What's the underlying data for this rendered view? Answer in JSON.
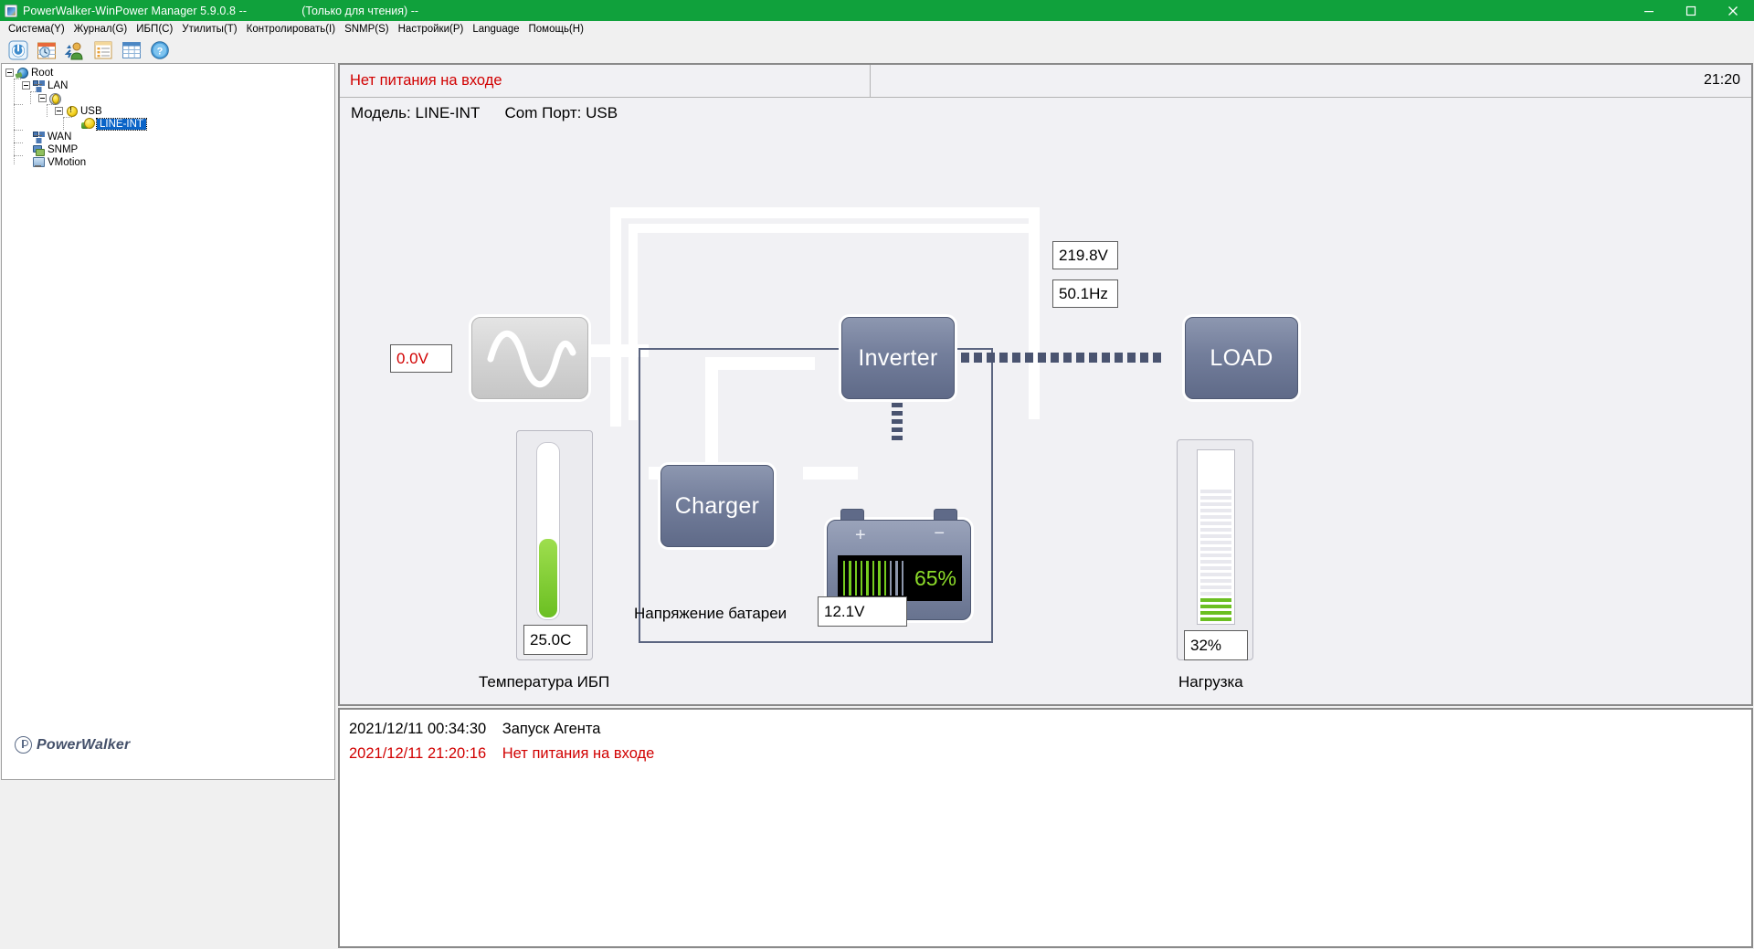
{
  "window": {
    "title": "PowerWalker-WinPower Manager 5.9.0.8 --",
    "readonly": "(Только для чтения) --",
    "app_icon": "java-coffee-icon",
    "minimize": "minimize-icon",
    "maximize": "maximize-icon",
    "close": "close-icon"
  },
  "menubar": {
    "items": [
      {
        "label": "Система(Y)"
      },
      {
        "label": "Журнал(G)"
      },
      {
        "label": "ИБП(C)"
      },
      {
        "label": "Утилиты(T)"
      },
      {
        "label": "Контролировать(I)"
      },
      {
        "label": "SNMP(S)"
      },
      {
        "label": "Настройки(P)"
      },
      {
        "label": "Language"
      },
      {
        "label": "Помощь(H)"
      }
    ]
  },
  "toolbar": {
    "buttons": [
      {
        "name": "power-button-icon"
      },
      {
        "name": "schedule-calendar-icon"
      },
      {
        "name": "user-shutdown-icon"
      },
      {
        "name": "event-log-icon"
      },
      {
        "name": "data-table-icon"
      },
      {
        "name": "help-question-icon"
      }
    ]
  },
  "tree": {
    "nodes": [
      {
        "label": "Root",
        "icon": "globe-icon",
        "selected": false
      },
      {
        "label": "LAN",
        "icon": "lan-icon",
        "selected": false
      },
      {
        "label": "",
        "icon": "gear-warning-icon",
        "selected": false
      },
      {
        "label": "USB",
        "icon": "warning-icon",
        "selected": false
      },
      {
        "label": "LINE-INT",
        "icon": "ups-warning-icon",
        "selected": true
      },
      {
        "label": "WAN",
        "icon": "lan-icon",
        "selected": false
      },
      {
        "label": "SNMP",
        "icon": "snmp-icon",
        "selected": false
      },
      {
        "label": "VMotion",
        "icon": "vmotion-icon",
        "selected": false
      }
    ],
    "brand": "PowerWalker"
  },
  "status": {
    "message": "Нет питания на входе",
    "time": "21:20",
    "alert_color": "#d10000"
  },
  "device": {
    "model_label": "Модель:",
    "model_value": "LINE-INT",
    "port_label": "Com Порт:",
    "port_value": "USB"
  },
  "diagram": {
    "input_voltage": "0.0V",
    "output_voltage": "219.8V",
    "output_frequency": "50.1Hz",
    "inverter_label": "Inverter",
    "charger_label": "Charger",
    "load_label": "LOAD",
    "battery_percent": "65%",
    "battery_percent_value": 65,
    "battery_bars_total": 11,
    "battery_bars_on": 8,
    "battery_plus": "+",
    "battery_minus": "−",
    "battery_voltage_label": "Напряжение батареи",
    "battery_voltage_value": "12.1V",
    "temperature_value": "25.0C",
    "temperature_label": "Температура ИБП",
    "temperature_fill_pct": 46,
    "load_value": "32%",
    "load_label_caption": "Нагрузка",
    "load_bars_total": 21,
    "load_bars_on": 4,
    "sine_icon": "sine-wave-icon"
  },
  "log": {
    "entries": [
      {
        "timestamp": "2021/12/11 00:34:30",
        "message": "Запуск Агента",
        "alert": false
      },
      {
        "timestamp": "2021/12/11 21:20:16",
        "message": "Нет питания на входе",
        "alert": true
      }
    ]
  }
}
